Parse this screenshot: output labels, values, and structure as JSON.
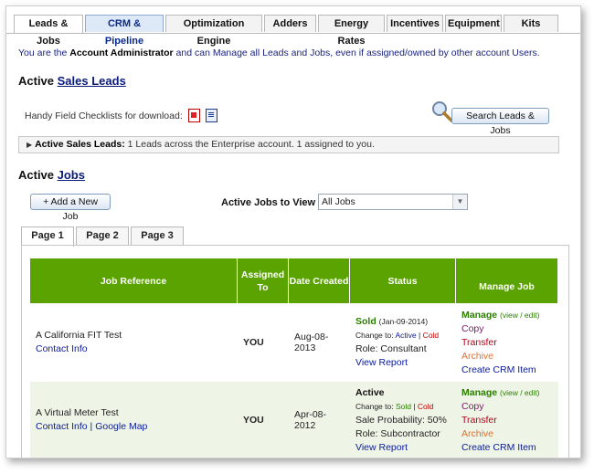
{
  "tabs": [
    {
      "label": "Leads & Jobs",
      "width": 76
    },
    {
      "label": "CRM & Pipeline",
      "width": 86
    },
    {
      "label": "Optimization Engine",
      "width": 106
    },
    {
      "label": "Adders",
      "width": 57
    },
    {
      "label": "Energy Rates",
      "width": 73
    },
    {
      "label": "Incentives",
      "width": 62
    },
    {
      "label": "Equipment",
      "width": 62
    },
    {
      "label": "Kits",
      "width": 60
    }
  ],
  "intro": {
    "prefix": "You are the ",
    "role": "Account Administrator",
    "suffix": " and can Manage all Leads and Jobs, even if assigned/owned by other account Users."
  },
  "sales_leads": {
    "heading_prefix": "Active ",
    "heading_link": "Sales Leads",
    "checklist_text": "Handy Field Checklists for download:",
    "search_button": "Search Leads & Jobs",
    "bar_label": "Active Sales Leads:",
    "bar_text": " 1 Leads across the Enterprise account. 1 assigned to you."
  },
  "jobs": {
    "heading_prefix": "Active ",
    "heading_link": "Jobs",
    "add_button": "+ Add a New Job",
    "filter_label": "Active Jobs to View",
    "filter_value": "All Jobs",
    "pages": [
      "Page 1",
      "Page 2",
      "Page 3"
    ],
    "headers": {
      "ref": "Job Reference",
      "assigned": "Assigned To",
      "date": "Date Created",
      "status": "Status",
      "manage": "Manage Job"
    },
    "rows": [
      {
        "name": "A California FIT Test",
        "contact": "Contact Info",
        "map": "",
        "sep": "",
        "assigned": "YOU",
        "date": "Aug-08-2013",
        "status_title": "Sold",
        "status_date": "(Jan-09-2014)",
        "change_to": "Change to:",
        "opt1": "Active",
        "opt2": "Cold",
        "line3": "Role: Consultant",
        "line4": "",
        "report": "View Report",
        "manage": "Manage",
        "view_edit": "(view / edit)",
        "copy": "Copy",
        "transfer": "Transfer",
        "archive": "Archive",
        "crm": "Create CRM Item"
      },
      {
        "name": "A Virtual Meter Test",
        "contact": "Contact Info",
        "map": "Google Map",
        "sep": " | ",
        "assigned": "YOU",
        "date": "Apr-08-2012",
        "status_title": "Active",
        "status_date": "",
        "change_to": "Change to:",
        "opt1": "Sold",
        "opt2": "Cold",
        "line3": "Sale Probability: 50%",
        "line4": "Role: Subcontractor",
        "report": "View Report",
        "manage": "Manage",
        "view_edit": "(view / edit)",
        "copy": "Copy",
        "transfer": "Transfer",
        "archive": "Archive",
        "crm": "Create CRM Item"
      }
    ]
  },
  "colors": {
    "header_green": "#5aa300",
    "link_blue": "#0a1a9a",
    "manage_green": "#2a7d00",
    "cold_red": "#cc0000",
    "archive_orange": "#e07030"
  }
}
